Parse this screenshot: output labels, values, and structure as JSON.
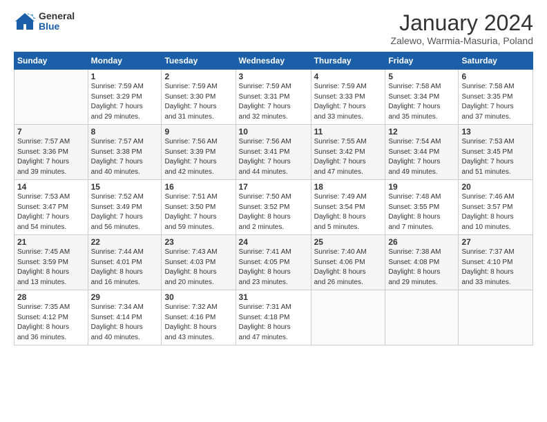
{
  "logo": {
    "general": "General",
    "blue": "Blue"
  },
  "title": "January 2024",
  "subtitle": "Zalewo, Warmia-Masuria, Poland",
  "weekdays": [
    "Sunday",
    "Monday",
    "Tuesday",
    "Wednesday",
    "Thursday",
    "Friday",
    "Saturday"
  ],
  "weeks": [
    [
      {
        "day": "",
        "info": ""
      },
      {
        "day": "1",
        "info": "Sunrise: 7:59 AM\nSunset: 3:29 PM\nDaylight: 7 hours\nand 29 minutes."
      },
      {
        "day": "2",
        "info": "Sunrise: 7:59 AM\nSunset: 3:30 PM\nDaylight: 7 hours\nand 31 minutes."
      },
      {
        "day": "3",
        "info": "Sunrise: 7:59 AM\nSunset: 3:31 PM\nDaylight: 7 hours\nand 32 minutes."
      },
      {
        "day": "4",
        "info": "Sunrise: 7:59 AM\nSunset: 3:33 PM\nDaylight: 7 hours\nand 33 minutes."
      },
      {
        "day": "5",
        "info": "Sunrise: 7:58 AM\nSunset: 3:34 PM\nDaylight: 7 hours\nand 35 minutes."
      },
      {
        "day": "6",
        "info": "Sunrise: 7:58 AM\nSunset: 3:35 PM\nDaylight: 7 hours\nand 37 minutes."
      }
    ],
    [
      {
        "day": "7",
        "info": "Sunrise: 7:57 AM\nSunset: 3:36 PM\nDaylight: 7 hours\nand 39 minutes."
      },
      {
        "day": "8",
        "info": "Sunrise: 7:57 AM\nSunset: 3:38 PM\nDaylight: 7 hours\nand 40 minutes."
      },
      {
        "day": "9",
        "info": "Sunrise: 7:56 AM\nSunset: 3:39 PM\nDaylight: 7 hours\nand 42 minutes."
      },
      {
        "day": "10",
        "info": "Sunrise: 7:56 AM\nSunset: 3:41 PM\nDaylight: 7 hours\nand 44 minutes."
      },
      {
        "day": "11",
        "info": "Sunrise: 7:55 AM\nSunset: 3:42 PM\nDaylight: 7 hours\nand 47 minutes."
      },
      {
        "day": "12",
        "info": "Sunrise: 7:54 AM\nSunset: 3:44 PM\nDaylight: 7 hours\nand 49 minutes."
      },
      {
        "day": "13",
        "info": "Sunrise: 7:53 AM\nSunset: 3:45 PM\nDaylight: 7 hours\nand 51 minutes."
      }
    ],
    [
      {
        "day": "14",
        "info": "Sunrise: 7:53 AM\nSunset: 3:47 PM\nDaylight: 7 hours\nand 54 minutes."
      },
      {
        "day": "15",
        "info": "Sunrise: 7:52 AM\nSunset: 3:49 PM\nDaylight: 7 hours\nand 56 minutes."
      },
      {
        "day": "16",
        "info": "Sunrise: 7:51 AM\nSunset: 3:50 PM\nDaylight: 7 hours\nand 59 minutes."
      },
      {
        "day": "17",
        "info": "Sunrise: 7:50 AM\nSunset: 3:52 PM\nDaylight: 8 hours\nand 2 minutes."
      },
      {
        "day": "18",
        "info": "Sunrise: 7:49 AM\nSunset: 3:54 PM\nDaylight: 8 hours\nand 5 minutes."
      },
      {
        "day": "19",
        "info": "Sunrise: 7:48 AM\nSunset: 3:55 PM\nDaylight: 8 hours\nand 7 minutes."
      },
      {
        "day": "20",
        "info": "Sunrise: 7:46 AM\nSunset: 3:57 PM\nDaylight: 8 hours\nand 10 minutes."
      }
    ],
    [
      {
        "day": "21",
        "info": "Sunrise: 7:45 AM\nSunset: 3:59 PM\nDaylight: 8 hours\nand 13 minutes."
      },
      {
        "day": "22",
        "info": "Sunrise: 7:44 AM\nSunset: 4:01 PM\nDaylight: 8 hours\nand 16 minutes."
      },
      {
        "day": "23",
        "info": "Sunrise: 7:43 AM\nSunset: 4:03 PM\nDaylight: 8 hours\nand 20 minutes."
      },
      {
        "day": "24",
        "info": "Sunrise: 7:41 AM\nSunset: 4:05 PM\nDaylight: 8 hours\nand 23 minutes."
      },
      {
        "day": "25",
        "info": "Sunrise: 7:40 AM\nSunset: 4:06 PM\nDaylight: 8 hours\nand 26 minutes."
      },
      {
        "day": "26",
        "info": "Sunrise: 7:38 AM\nSunset: 4:08 PM\nDaylight: 8 hours\nand 29 minutes."
      },
      {
        "day": "27",
        "info": "Sunrise: 7:37 AM\nSunset: 4:10 PM\nDaylight: 8 hours\nand 33 minutes."
      }
    ],
    [
      {
        "day": "28",
        "info": "Sunrise: 7:35 AM\nSunset: 4:12 PM\nDaylight: 8 hours\nand 36 minutes."
      },
      {
        "day": "29",
        "info": "Sunrise: 7:34 AM\nSunset: 4:14 PM\nDaylight: 8 hours\nand 40 minutes."
      },
      {
        "day": "30",
        "info": "Sunrise: 7:32 AM\nSunset: 4:16 PM\nDaylight: 8 hours\nand 43 minutes."
      },
      {
        "day": "31",
        "info": "Sunrise: 7:31 AM\nSunset: 4:18 PM\nDaylight: 8 hours\nand 47 minutes."
      },
      {
        "day": "",
        "info": ""
      },
      {
        "day": "",
        "info": ""
      },
      {
        "day": "",
        "info": ""
      }
    ]
  ]
}
